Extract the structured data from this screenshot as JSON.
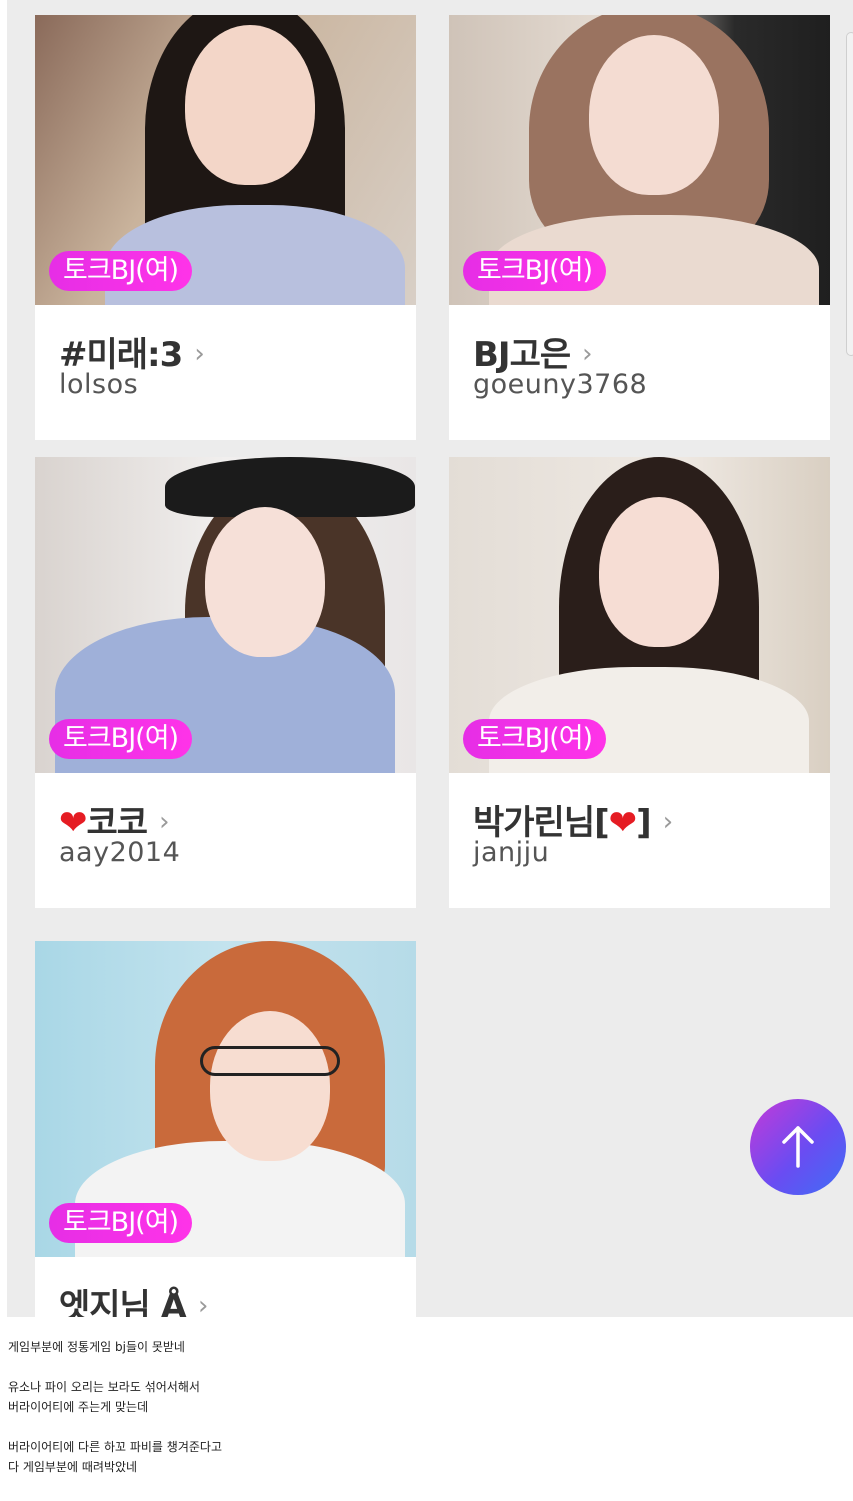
{
  "cards": [
    {
      "badge": "토크BJ(여)",
      "name": "#미래:3",
      "user_id": "lolsos"
    },
    {
      "badge": "토크BJ(여)",
      "name": "BJ고은",
      "user_id": "goeuny3768"
    },
    {
      "badge": "토크BJ(여)",
      "name_heart": "❤",
      "name": "코코",
      "user_id": "aay2014"
    },
    {
      "badge": "토크BJ(여)",
      "name": "박가린님[",
      "name_heart": "❤",
      "name_end": "]",
      "user_id": "janjju"
    },
    {
      "badge": "토크BJ(여)",
      "name": "엣지님 Å"
    }
  ],
  "chevron": "›",
  "scroll_top_icon": "arrow-up-icon",
  "caption_lines": [
    "게임부분에 정통게임 bj들이 못받네",
    "",
    "유소나 파이 오리는 보라도 섞어서해서",
    "버라이어티에 주는게 맞는데",
    "",
    "버라이어티에 다른 하꼬 파비를 챙겨준다고",
    "다 게임부분에 때려박았네"
  ],
  "colors": {
    "badge": "#ff33e8",
    "page_bg": "#ececec",
    "heart": "#e51c23"
  }
}
